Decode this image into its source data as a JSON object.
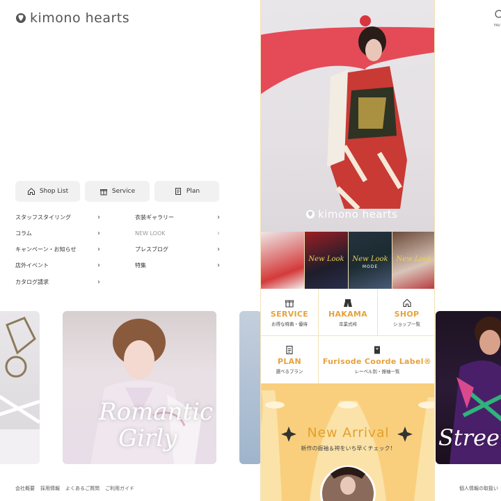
{
  "brand": {
    "logo_text": "kimono hearts",
    "fav_label": "FAV"
  },
  "nav": {
    "shop_list": "Shop List",
    "service": "Service",
    "plan": "Plan"
  },
  "links_left": [
    "スタッフスタイリング",
    "コラム",
    "キャンペーン・お知らせ",
    "店外イベント",
    "カタログ請求"
  ],
  "links_right": [
    "衣装ギャラリー",
    "NEW LOOK",
    "プレスブログ",
    "特集"
  ],
  "cards": {
    "mid_title_1": "Romantic",
    "mid_title_2": "Girly",
    "right_title": "Street"
  },
  "footer": {
    "links": [
      "会社概要",
      "採用情報",
      "よくあるご質問",
      "ご利用ガイド"
    ],
    "right": "個人情報の取扱い"
  },
  "center": {
    "hero_logo": "kimono hearts",
    "thumbs": [
      {
        "label": "",
        "sub": ""
      },
      {
        "label": "New Look",
        "sub": ""
      },
      {
        "label": "New Look",
        "sub": "MODE"
      },
      {
        "label": "New Look",
        "sub": ""
      }
    ],
    "services": [
      {
        "title": "SERVICE",
        "sub": "お得な特典・優待",
        "icon": "gift-icon"
      },
      {
        "title": "HAKAMA",
        "sub": "卒業式袴",
        "icon": "hakama-icon"
      },
      {
        "title": "SHOP",
        "sub": "ショップ一覧",
        "icon": "home-icon"
      },
      {
        "title": "PLAN",
        "sub": "選べるプラン",
        "icon": "document-icon"
      },
      {
        "title": "Furisode Coorde Label®",
        "sub": "レーベル別・振袖一覧",
        "icon": "kimono-icon"
      }
    ],
    "arrival_title": "New Arrival",
    "arrival_sub": "新作の振袖＆袴をいち早くチェック！"
  },
  "colors": {
    "accent": "#e6a23c",
    "border": "#f3e2b8",
    "arrival_bg": "#f9cf7d",
    "button_bg": "#f1f1f1"
  }
}
